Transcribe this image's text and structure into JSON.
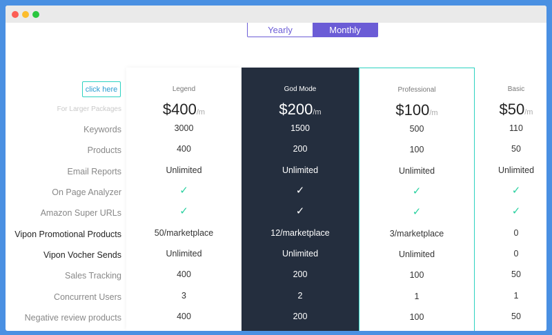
{
  "toggle": {
    "yearly": "Yearly",
    "monthly": "Monthly"
  },
  "sidebar": {
    "click_here": "click here",
    "larger_packages": "For Larger Packages"
  },
  "rows": [
    "Keywords",
    "Products",
    "Email Reports",
    "On Page Analyzer",
    "Amazon Super URLs",
    "Vipon Promotional Products",
    "Vipon Vocher Sends",
    "Sales Tracking",
    "Concurrent Users",
    "Negative review products"
  ],
  "plans": [
    {
      "name": "Legend",
      "price": "$400",
      "per": "/m",
      "values": [
        "3000",
        "400",
        "Unlimited",
        "✓",
        "✓",
        "50/marketplace",
        "Unlimited",
        "400",
        "3",
        "400"
      ]
    },
    {
      "name": "God Mode",
      "price": "$200",
      "per": "/m",
      "values": [
        "1500",
        "200",
        "Unlimited",
        "✓",
        "✓",
        "12/marketplace",
        "Unlimited",
        "200",
        "2",
        "200"
      ]
    },
    {
      "name": "Professional",
      "price": "$100",
      "per": "/m",
      "values": [
        "500",
        "100",
        "Unlimited",
        "✓",
        "✓",
        "3/marketplace",
        "Unlimited",
        "100",
        "1",
        "100"
      ]
    },
    {
      "name": "Basic",
      "price": "$50",
      "per": "/m",
      "values": [
        "110",
        "50",
        "Unlimited",
        "✓",
        "✓",
        "0",
        "0",
        "50",
        "1",
        "50"
      ]
    }
  ],
  "colors": {
    "accent": "#6b5cd6",
    "teal": "#2ad1c0",
    "dark": "#242e3e",
    "frame": "#4a90e2"
  }
}
